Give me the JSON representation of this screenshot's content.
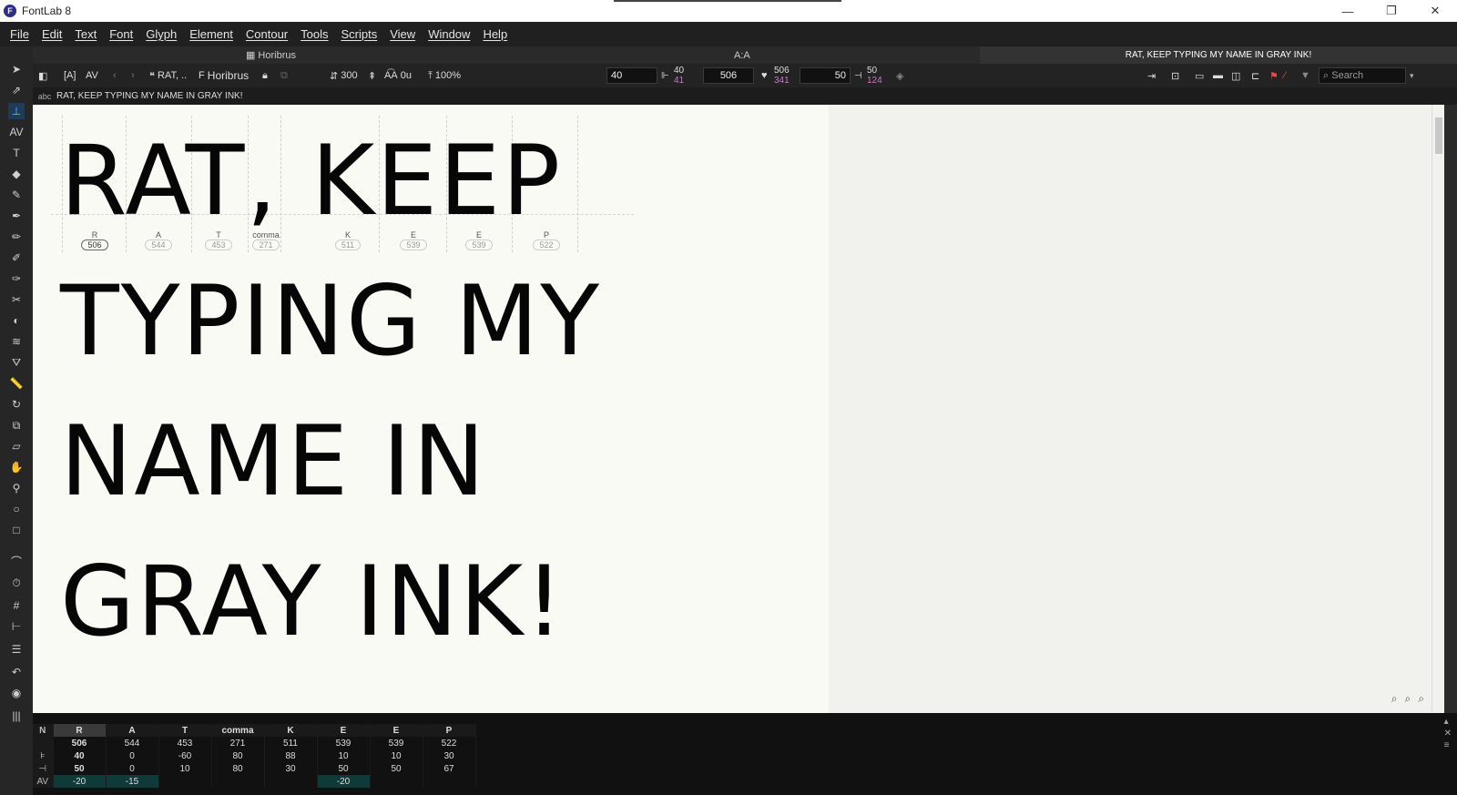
{
  "window": {
    "title": "FontLab 8",
    "controls": [
      "—",
      "❐",
      "✕"
    ]
  },
  "menu": [
    "File",
    "Edit",
    "Text",
    "Font",
    "Glyph",
    "Element",
    "Contour",
    "Tools",
    "Scripts",
    "View",
    "Window",
    "Help"
  ],
  "tabs": {
    "left_label": "Horibrus",
    "center_label": "A:A",
    "right_label": "RAT, KEEP TYPING MY NAME IN GRAY INK!"
  },
  "toolbar": {
    "text_short": "RAT, ..",
    "font_name": "Horibrus",
    "size": "300",
    "tracking": "0u",
    "zoom": "100%",
    "lsb_field": "40",
    "lsb_value": "40",
    "lsb_purple": "41",
    "width_field": "506",
    "width_value": "506",
    "width_purple": "341",
    "rsb_field": "50",
    "rsb_value": "50",
    "rsb_purple": "124",
    "search_placeholder": "Search"
  },
  "textbar": {
    "prefix": "abc",
    "text": "RAT, KEEP TYPING MY NAME IN GRAY INK!"
  },
  "canvas": {
    "lines": [
      "RAT, KEEP",
      "TYPING MY",
      "NAME IN",
      "GRAY INK!"
    ],
    "glyphs": [
      {
        "name": "R",
        "width": "506"
      },
      {
        "name": "A",
        "width": "544"
      },
      {
        "name": "T",
        "width": "453"
      },
      {
        "name": "comma",
        "width": "271"
      },
      {
        "name": "K",
        "width": "511"
      },
      {
        "name": "E",
        "width": "539"
      },
      {
        "name": "E",
        "width": "539"
      },
      {
        "name": "P",
        "width": "522"
      }
    ]
  },
  "metrics_table": {
    "row_labels": [
      "N",
      "",
      "⊧",
      "⊣",
      "AV"
    ],
    "names": [
      "R",
      "A",
      "T",
      "comma",
      "K",
      "E",
      "E",
      "P"
    ],
    "widths": [
      "506",
      "544",
      "453",
      "271",
      "511",
      "539",
      "539",
      "522"
    ],
    "lsb": [
      "40",
      "0",
      "-60",
      "80",
      "88",
      "10",
      "10",
      "30"
    ],
    "rsb": [
      "50",
      "0",
      "10",
      "80",
      "30",
      "50",
      "50",
      "67"
    ],
    "kerning": [
      "-20",
      "-15",
      "",
      "",
      "",
      "-20",
      "",
      ""
    ]
  }
}
